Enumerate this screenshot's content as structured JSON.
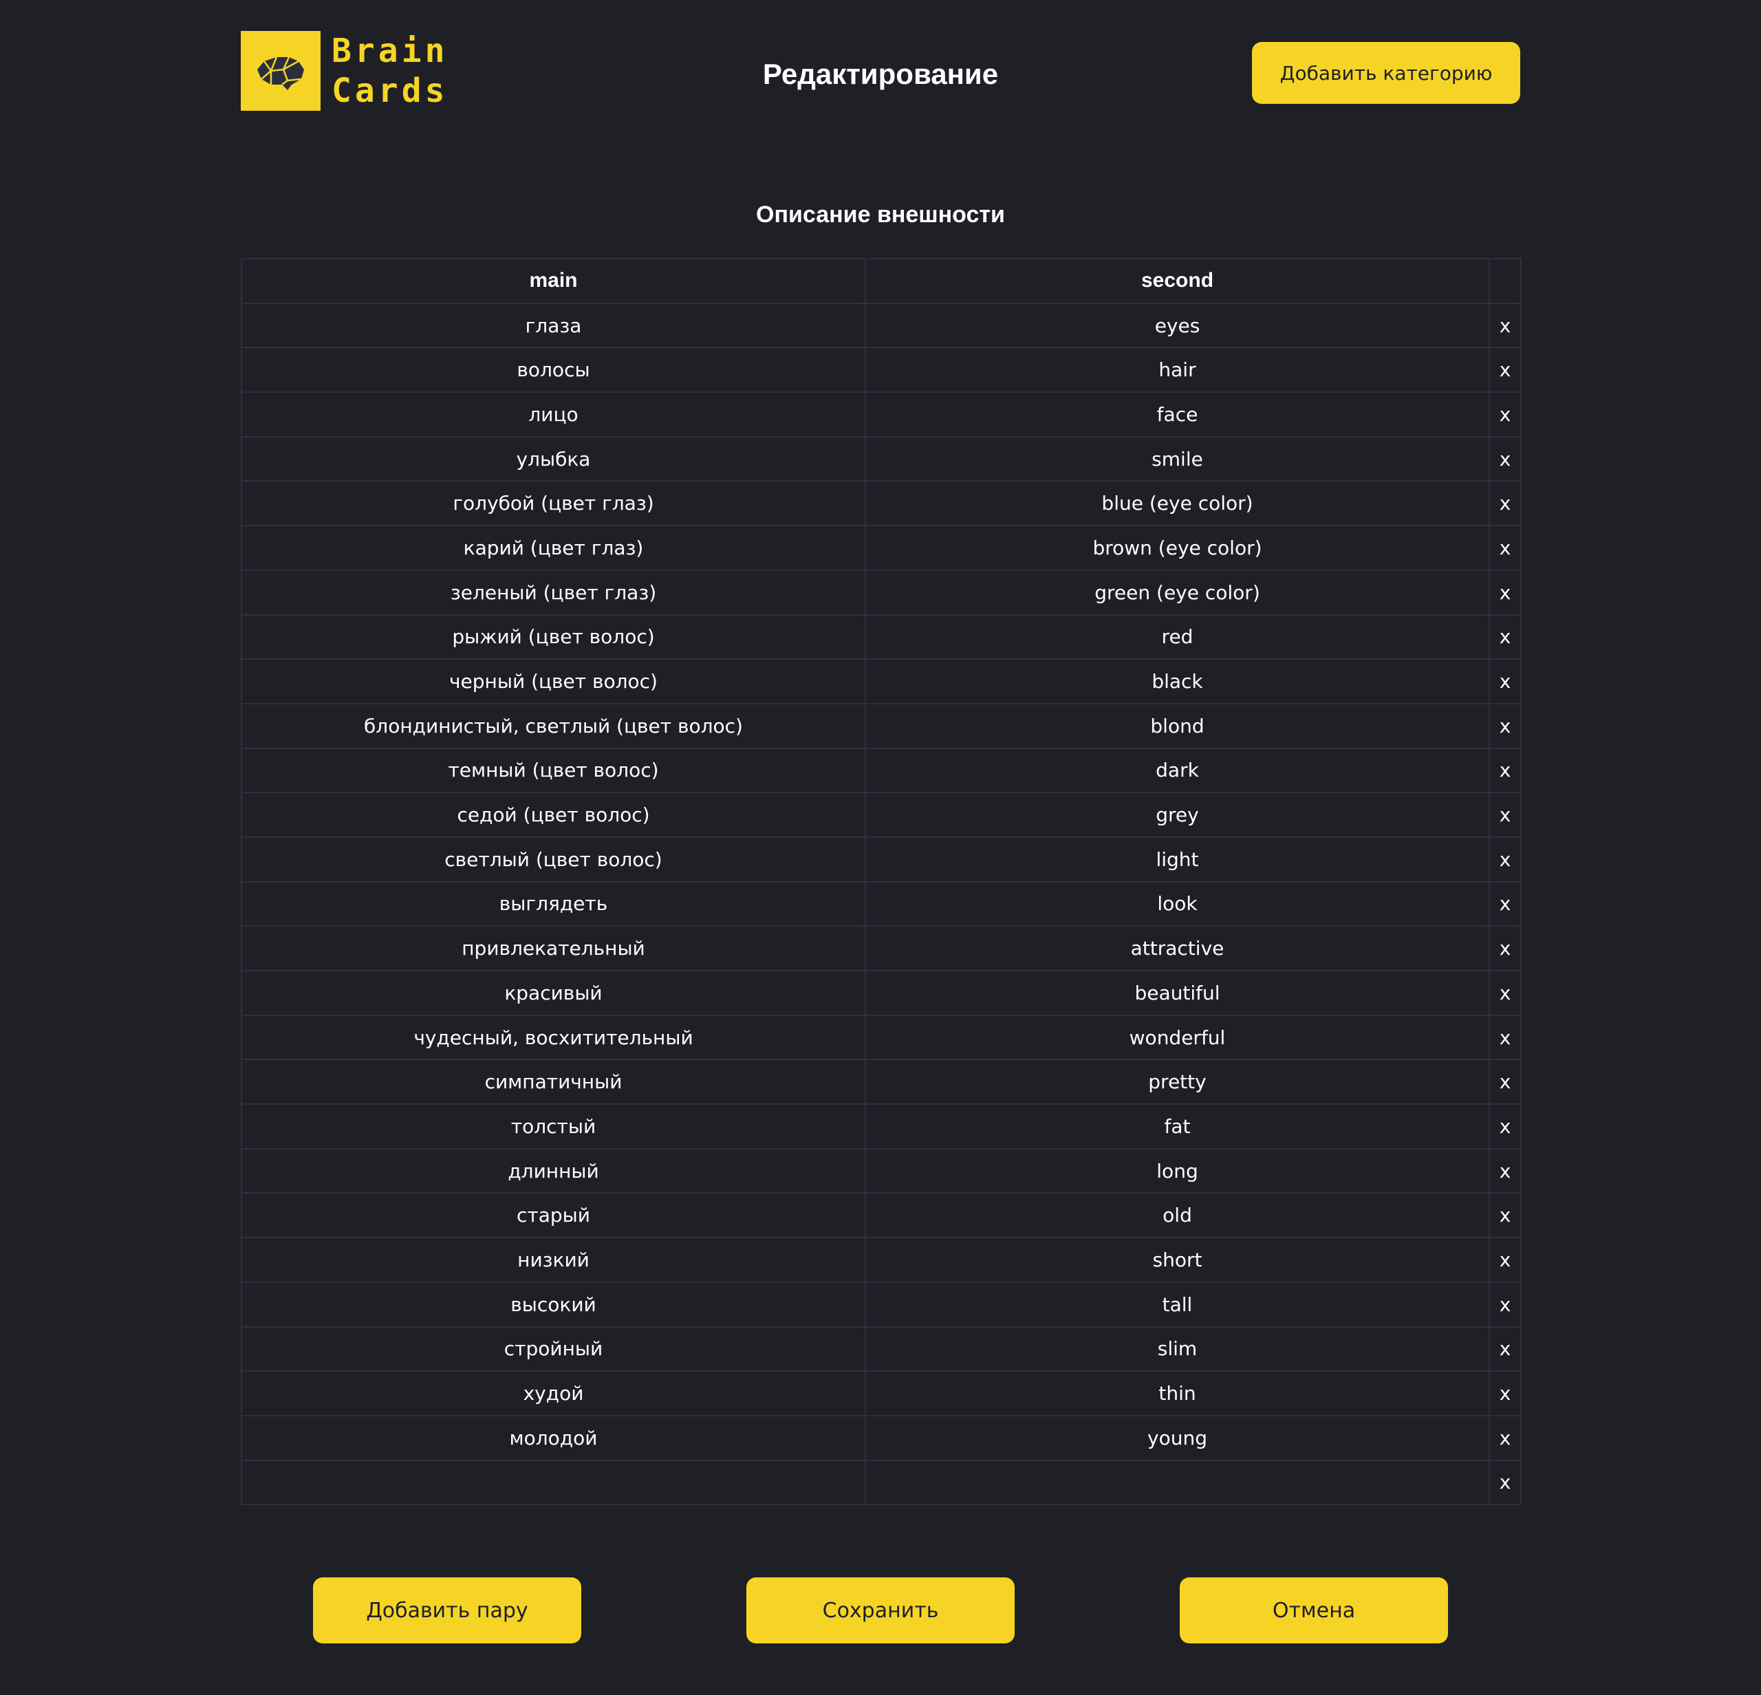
{
  "logo": {
    "line1": "Brain",
    "line2": "Cards",
    "icon": "brain-icon"
  },
  "header": {
    "title": "Редактирование",
    "add_category_label": "Добавить категорию"
  },
  "category": {
    "title": "Описание внешности"
  },
  "table": {
    "headers": {
      "main": "main",
      "second": "second"
    },
    "delete_label": "x",
    "rows": [
      {
        "main": "глаза",
        "second": "eyes"
      },
      {
        "main": "волосы",
        "second": "hair"
      },
      {
        "main": "лицо",
        "second": "face"
      },
      {
        "main": "улыбка",
        "second": "smile"
      },
      {
        "main": "голубой (цвет глаз)",
        "second": "blue (eye color)"
      },
      {
        "main": "карий (цвет глаз)",
        "second": "brown (eye color)"
      },
      {
        "main": "зеленый (цвет глаз)",
        "second": "green (eye color)"
      },
      {
        "main": "рыжий (цвет волос)",
        "second": "red"
      },
      {
        "main": "черный (цвет волос)",
        "second": "black"
      },
      {
        "main": "блондинистый, светлый (цвет волос)",
        "second": "blond"
      },
      {
        "main": "темный (цвет волос)",
        "second": "dark"
      },
      {
        "main": "седой (цвет волос)",
        "second": "grey"
      },
      {
        "main": "светлый (цвет волос)",
        "second": "light"
      },
      {
        "main": "выглядеть",
        "second": "look"
      },
      {
        "main": "привлекательный",
        "second": "attractive"
      },
      {
        "main": "красивый",
        "second": "beautiful"
      },
      {
        "main": "чудесный, восхитительный",
        "second": "wonderful"
      },
      {
        "main": "симпатичный",
        "second": "pretty"
      },
      {
        "main": "толстый",
        "second": "fat"
      },
      {
        "main": "длинный",
        "second": "long"
      },
      {
        "main": "старый",
        "second": "old"
      },
      {
        "main": "низкий",
        "second": "short"
      },
      {
        "main": "высокий",
        "second": "tall"
      },
      {
        "main": "стройный",
        "second": "slim"
      },
      {
        "main": "худой",
        "second": "thin"
      },
      {
        "main": "молодой",
        "second": "young"
      },
      {
        "main": "",
        "second": ""
      }
    ]
  },
  "footer": {
    "add_pair_label": "Добавить пару",
    "save_label": "Сохранить",
    "cancel_label": "Отмена"
  },
  "colors": {
    "background": "#1f1f26",
    "accent": "#f5d425",
    "border": "#2d3042",
    "text": "#ffffff"
  }
}
